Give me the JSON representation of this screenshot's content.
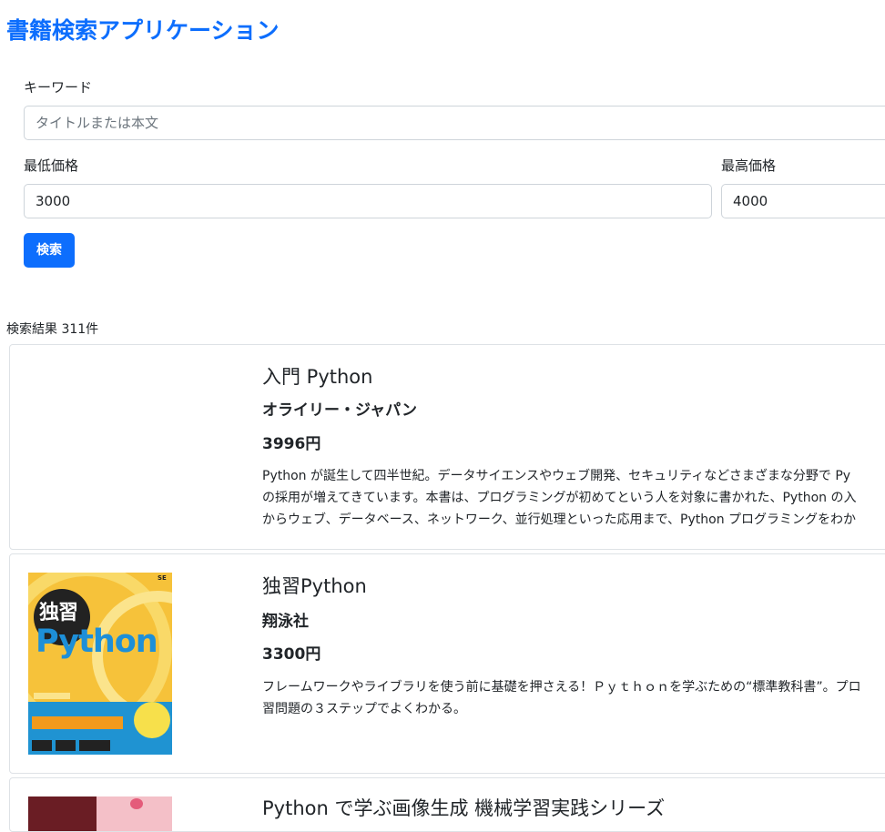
{
  "app": {
    "title": "書籍検索アプリケーション"
  },
  "search": {
    "keyword_label": "キーワード",
    "keyword_placeholder": "タイトルまたは本文",
    "keyword_value": "",
    "min_price_label": "最低価格",
    "min_price_value": "3000",
    "max_price_label": "最高価格",
    "max_price_value": "4000",
    "submit_label": "検索"
  },
  "results": {
    "count_text": "検索結果 311件",
    "books": [
      {
        "title": "入門 Python",
        "publisher": "オライリー・ジャパン",
        "price": "3996円",
        "description_lines": [
          "Python が誕生して四半世紀。データサイエンスやウェブ開発、セキュリティなどさまざまな分野で Py",
          "の採用が増えてきています。本書は、プログラミングが初めてという人を対象に書かれた、Python の入",
          "からウェブ、データベース、ネットワーク、並行処理といった応用まで、Python プログラミングをわか"
        ],
        "cover": null
      },
      {
        "title": "独習Python",
        "publisher": "翔泳社",
        "price": "3300円",
        "description_lines": [
          "フレームワークやライブラリを使う前に基礎を押さえる！Ｐｙｔｈｏｎを学ぶための“標準教科書”。プロ",
          "習問題の３ステップでよくわかる。"
        ],
        "cover": {
          "brand": "SE",
          "badge_text": "独習",
          "word": "Python",
          "colors": {
            "background": "#f6c23a",
            "word": "#1d8fd8",
            "band": "#1f93d2"
          }
        }
      },
      {
        "title": "Python で学ぶ画像生成 機械学習実践シリーズ",
        "cover": {
          "colors": {
            "left": "#6a1d24",
            "right": "#f4c0c8"
          }
        }
      }
    ]
  },
  "colors": {
    "accent": "#0d6efd",
    "border": "#dee2e6",
    "input_border": "#ced4da"
  }
}
